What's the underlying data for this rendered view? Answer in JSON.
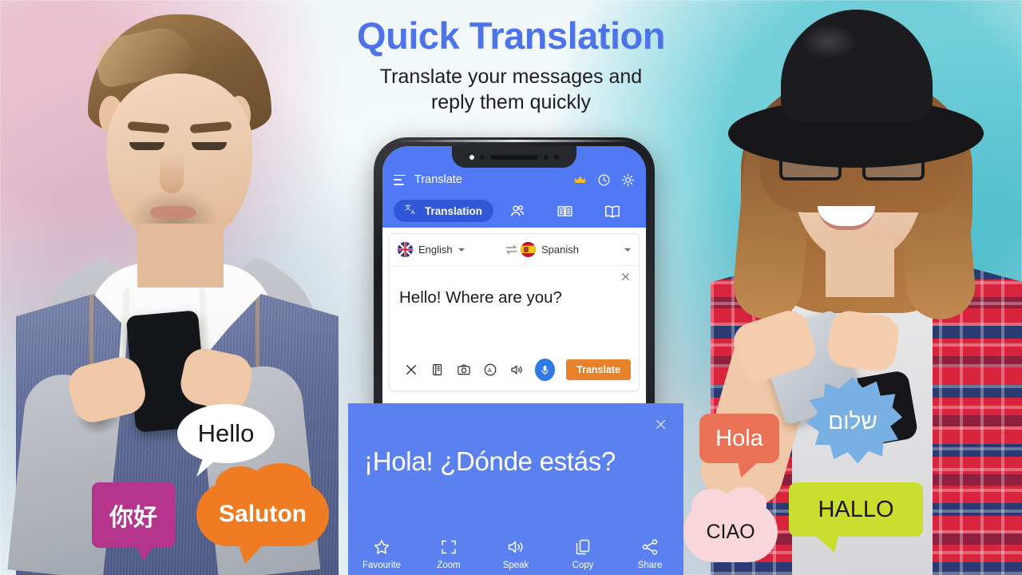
{
  "headline": {
    "title": "Quick Translation",
    "subtitle_line1": "Translate your messages and",
    "subtitle_line2": "reply them quickly",
    "title_color": "#4d73e8"
  },
  "app": {
    "header": {
      "menu_icon": "hamburger-menu-icon",
      "title": "Translate",
      "icons": [
        {
          "name": "crown-icon",
          "color": "#f4bb1c"
        },
        {
          "name": "clock-history-icon",
          "color": "#ffffff"
        },
        {
          "name": "brightness-sun-icon",
          "color": "#ffffff"
        }
      ],
      "background": "#5279f5"
    },
    "tabs": [
      {
        "label": "Translation",
        "icon": "translate-icon",
        "active": true
      },
      {
        "label": "",
        "icon": "conversation-people-icon",
        "active": false
      },
      {
        "label": "",
        "icon": "phrasebook-cards-icon",
        "active": false
      },
      {
        "label": "",
        "icon": "dictionary-book-icon",
        "active": false
      }
    ],
    "language_bar": {
      "source": {
        "language": "English",
        "flag": "uk-flag-icon"
      },
      "target": {
        "language": "Spanish",
        "flag": "spain-flag-icon"
      },
      "swap_icon": "swap-arrows-icon"
    },
    "input": {
      "text": "Hello! Where are you?",
      "clear_icon": "close-x-icon",
      "tools": [
        {
          "name": "clear-icon"
        },
        {
          "name": "dictionary-icon"
        },
        {
          "name": "camera-icon"
        },
        {
          "name": "handwriting-icon"
        },
        {
          "name": "speaker-icon"
        }
      ],
      "mic_icon": "microphone-icon",
      "mic_color": "#2f7ae5",
      "translate_label": "Translate",
      "translate_color": "#e8822a"
    }
  },
  "result": {
    "text": "¡Hola! ¿Dónde estás?",
    "close_icon": "close-x-icon",
    "background": "#5b80f0",
    "actions": [
      {
        "label": "Favourite",
        "icon": "star-icon"
      },
      {
        "label": "Zoom",
        "icon": "zoom-frame-icon"
      },
      {
        "label": "Speak",
        "icon": "speaker-icon"
      },
      {
        "label": "Copy",
        "icon": "copy-icon"
      },
      {
        "label": "Share",
        "icon": "share-icon"
      }
    ]
  },
  "bubbles": {
    "hello": {
      "text": "Hello",
      "color": "#ffffff"
    },
    "nihao": {
      "text": "你好",
      "color": "#b5348c"
    },
    "saluton": {
      "text": "Saluton",
      "color": "#ef7c22"
    },
    "hola": {
      "text": "Hola",
      "color": "#ea7257"
    },
    "shalom": {
      "text": "שלום",
      "color": "#79b0e3"
    },
    "ciao": {
      "text": "CIAO",
      "color": "#f9d6d9"
    },
    "hallo": {
      "text": "HALLO",
      "color": "#cade2f"
    }
  }
}
